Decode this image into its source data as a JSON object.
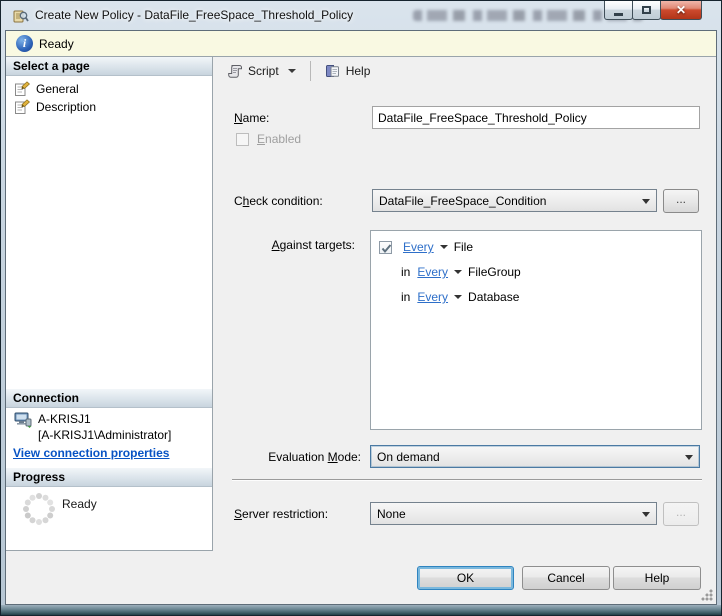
{
  "window": {
    "title": "Create New Policy - DataFile_FreeSpace_Threshold_Policy"
  },
  "statusbar": {
    "text": "Ready"
  },
  "toolbar": {
    "script_label": "Script",
    "help_label": "Help"
  },
  "sidebar": {
    "select_page": {
      "header": "Select a page",
      "items": [
        {
          "label": "General"
        },
        {
          "label": "Description"
        }
      ]
    },
    "connection": {
      "header": "Connection",
      "server": "A-KRISJ1",
      "account": "[A-KRISJ1\\Administrator]",
      "link": "View connection properties"
    },
    "progress": {
      "header": "Progress",
      "status": "Ready"
    }
  },
  "form": {
    "name": {
      "pre": "",
      "mn": "N",
      "post": "ame:",
      "value": "DataFile_FreeSpace_Threshold_Policy"
    },
    "enabled": {
      "pre": "",
      "mn": "E",
      "post": "nabled",
      "checked": false
    },
    "check_condition": {
      "pre": "C",
      "mn": "h",
      "post": "eck condition:",
      "value": "DataFile_FreeSpace_Condition",
      "browse": "..."
    },
    "against_targets": {
      "pre": "",
      "mn": "A",
      "post": "gainst targets:",
      "rows": [
        {
          "prefix": "",
          "quantifier": "Every",
          "target": "File",
          "checked": true
        },
        {
          "prefix": "in",
          "quantifier": "Every",
          "target": "FileGroup"
        },
        {
          "prefix": "in",
          "quantifier": "Every",
          "target": "Database"
        }
      ]
    },
    "evaluation_mode": {
      "pre": "Evaluation ",
      "mn": "M",
      "post": "ode:",
      "value": "On demand"
    },
    "server_restriction": {
      "pre": "",
      "mn": "S",
      "post": "erver restriction:",
      "value": "None",
      "browse": "..."
    }
  },
  "footer": {
    "ok": "OK",
    "cancel": "Cancel",
    "help": "Help"
  },
  "colors": {
    "titlebar": "#cfdbe6",
    "status_bg": "#f9f9e2",
    "link_blue": "#0853c4",
    "every_link_blue": "#2e6fc9",
    "close_button_red": "#cc4a2e",
    "panel_bg": "#f0f0f0"
  }
}
